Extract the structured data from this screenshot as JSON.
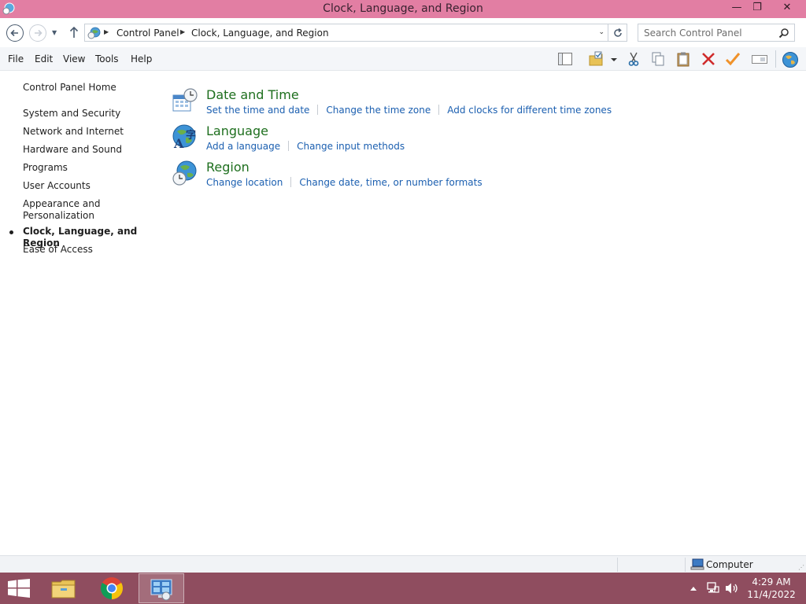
{
  "window": {
    "title": "Clock, Language, and Region",
    "minimize": "—",
    "maximize": "❐",
    "close": "✕"
  },
  "address": {
    "crumbs": [
      "Control Panel",
      "Clock, Language, and Region"
    ],
    "search_placeholder": "Search Control Panel"
  },
  "menu": [
    "File",
    "Edit",
    "View",
    "Tools",
    "Help"
  ],
  "toolbar_icons": [
    "layout-pane-icon",
    "folder-checkbox-icon",
    "cut-icon",
    "copy-icon",
    "paste-icon",
    "delete-icon",
    "check-icon",
    "rename-icon",
    "globe-icon"
  ],
  "leftnav": {
    "home": "Control Panel Home",
    "items": [
      "System and Security",
      "Network and Internet",
      "Hardware and Sound",
      "Programs",
      "User Accounts",
      "Appearance and Personalization",
      "Clock, Language, and Region",
      "Ease of Access"
    ],
    "current": "Clock, Language, and Region"
  },
  "categories": [
    {
      "title": "Date and Time",
      "icon": "calendar-clock-icon",
      "links": [
        "Set the time and date",
        "Change the time zone",
        "Add clocks for different time zones"
      ]
    },
    {
      "title": "Language",
      "icon": "language-globe-icon",
      "links": [
        "Add a language",
        "Change input methods"
      ]
    },
    {
      "title": "Region",
      "icon": "region-globe-icon",
      "links": [
        "Change location",
        "Change date, time, or number formats"
      ]
    }
  ],
  "statusbar": {
    "location": "Computer"
  },
  "taskbar": {
    "time": "4:29 AM",
    "date": "11/4/2022",
    "apps": [
      "file-explorer-icon",
      "chrome-icon",
      "control-panel-icon"
    ]
  },
  "colors": {
    "titlebar": "#e27ea3",
    "taskbar": "#8f4d5f",
    "link": "#1b5fb0",
    "category_title": "#1e6f1e"
  }
}
